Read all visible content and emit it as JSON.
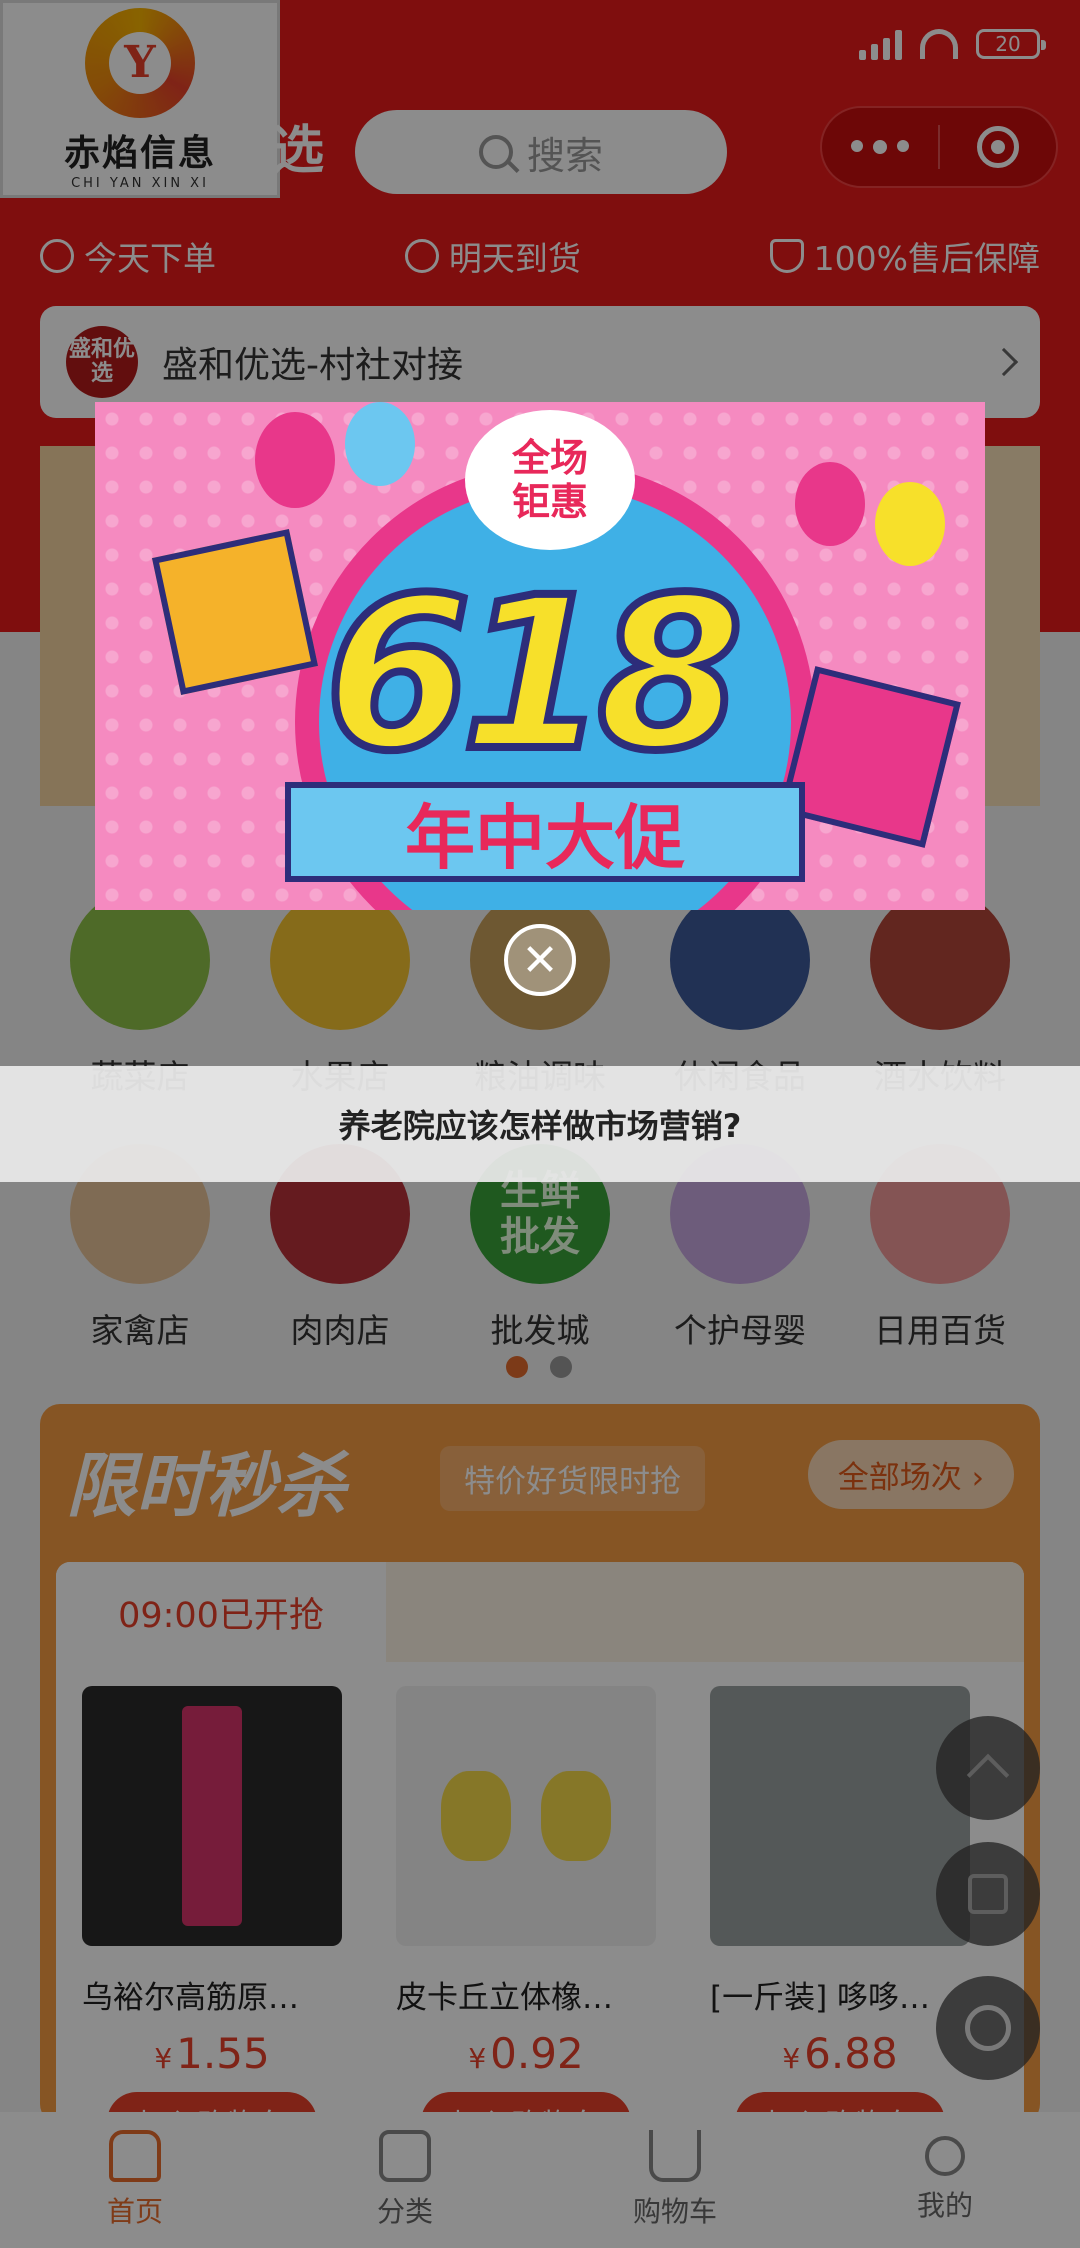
{
  "status_bar": {
    "battery": "20"
  },
  "logo": {
    "cn": "赤焰信息",
    "en": "CHI YAN XIN XI",
    "letter": "Y"
  },
  "header": {
    "title_tail": "选",
    "search_placeholder": "搜索"
  },
  "promises": [
    {
      "label": "今天下单",
      "icon": "thumb-up-icon"
    },
    {
      "label": "明天到货",
      "icon": "clock-icon"
    },
    {
      "label": "100%售后保障",
      "icon": "shield-icon"
    }
  ],
  "notice": {
    "logo_text": "盛和优选",
    "text": "盛和优选-村社对接"
  },
  "popup": {
    "cloud_line1": "全场",
    "cloud_line2": "钜惠",
    "big_number": "618",
    "ribbon": "年中大促",
    "close": "✕"
  },
  "categories_row1": [
    {
      "label": "蔬菜店",
      "color": "#8fc14a"
    },
    {
      "label": "水果店",
      "color": "#f4c430"
    },
    {
      "label": "粮油调味",
      "color": "#c9a15c"
    },
    {
      "label": "休闲食品",
      "color": "#3c5a9a"
    },
    {
      "label": "酒水饮料",
      "color": "#b2453a"
    }
  ],
  "categories_row2": [
    {
      "label": "家禽店",
      "color": "#e8c49a"
    },
    {
      "label": "肉肉店",
      "color": "#b8323a"
    },
    {
      "label": "批发城",
      "color": "#3aa33a",
      "img_text": "生鲜批发"
    },
    {
      "label": "个护母婴",
      "color": "#c7a8e0"
    },
    {
      "label": "日用百货",
      "color": "#f09a9a"
    }
  ],
  "flash_sale": {
    "title": "限时秒杀",
    "subtitle": "特价好货限时抢",
    "all_label": "全部场次 ›",
    "time_label": "09:00已开抢",
    "products": [
      {
        "name": "乌裕尔高筋原…",
        "price": "1.55",
        "color": "#d8346a"
      },
      {
        "name": "皮卡丘立体橡…",
        "price": "0.92",
        "color": "#f5d94a"
      },
      {
        "name": "[一斤装] 哆哆…",
        "price": "6.88",
        "color": "#9aa0a0"
      }
    ],
    "currency": "¥",
    "add_label": "加入购物车"
  },
  "headline": "养老院应该怎样做市场营销?",
  "tabbar": [
    {
      "label": "首页",
      "icon": "home-icon",
      "active": true
    },
    {
      "label": "分类",
      "icon": "list-icon",
      "active": false
    },
    {
      "label": "购物车",
      "icon": "cart-icon",
      "active": false
    },
    {
      "label": "我的",
      "icon": "user-icon",
      "active": false
    }
  ],
  "colors": {
    "brand_red": "#e81b1b",
    "accent_orange": "#e86c2c"
  }
}
